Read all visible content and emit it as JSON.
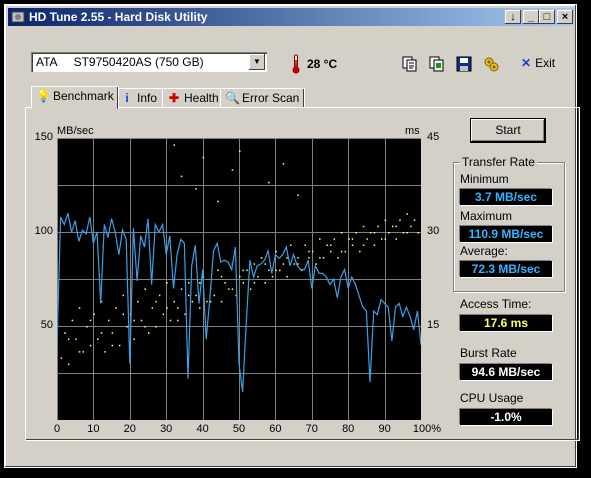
{
  "window": {
    "title": "HD Tune 2.55 - Hard Disk Utility",
    "controls": [
      "↓",
      "_",
      "□",
      "×"
    ]
  },
  "toolbar": {
    "drive": "ATA     ST9750420AS (750 GB)",
    "temperature": "28 °C",
    "tools": [
      "copy-text-icon",
      "copy-screen-icon",
      "save-icon",
      "options-icon"
    ],
    "exit_label": "Exit"
  },
  "tabs": [
    {
      "label": "Benchmark",
      "icon": "benchmark-icon",
      "active": true
    },
    {
      "label": "Info",
      "icon": "info-icon",
      "active": false
    },
    {
      "label": "Health",
      "icon": "health-icon",
      "active": false
    },
    {
      "label": "Error Scan",
      "icon": "error-scan-icon",
      "active": false
    }
  ],
  "benchmark": {
    "start_label": "Start",
    "left_unit": "MB/sec",
    "right_unit": "ms",
    "transfer_rate": {
      "group_label": "Transfer Rate",
      "minimum_label": "Minimum",
      "minimum": "3.7 MB/sec",
      "maximum_label": "Maximum",
      "maximum": "110.9 MB/sec",
      "average_label": "Average:",
      "average": "72.3 MB/sec"
    },
    "access_time_label": "Access Time:",
    "access_time": "17.6 ms",
    "burst_rate_label": "Burst Rate",
    "burst_rate": "94.6 MB/sec",
    "cpu_usage_label": "CPU Usage",
    "cpu_usage": "-1.0%",
    "colors": {
      "transfer_line": "#3ca0e6",
      "access_dots": "#ffff80",
      "value_blue": "#33b5ff",
      "value_yellow": "#ffff66",
      "value_white": "#ffffff"
    }
  },
  "chart_data": {
    "type": "line",
    "x_ticks": [
      "0",
      "10",
      "20",
      "30",
      "40",
      "50",
      "60",
      "70",
      "80",
      "90",
      "100%"
    ],
    "y_left_ticks": [
      "150",
      "100",
      "50"
    ],
    "y_right_ticks": [
      "45",
      "30",
      "15"
    ],
    "ylim_left": [
      0,
      150
    ],
    "ylim_right": [
      0,
      45
    ],
    "xlim": [
      0,
      100
    ],
    "grid": true,
    "series": [
      {
        "x": [
          0,
          1,
          2,
          3,
          4,
          5,
          6,
          7,
          8,
          9,
          10,
          11,
          12,
          13,
          14,
          15,
          16,
          17,
          18,
          19,
          20,
          21,
          22,
          23,
          24,
          25,
          26,
          27,
          28,
          29,
          30,
          31,
          32,
          33,
          34,
          35,
          36,
          37,
          38,
          39,
          40,
          41,
          42,
          43,
          44,
          45,
          46,
          47,
          48,
          49,
          50,
          51,
          52,
          53,
          54,
          55,
          56,
          57,
          58,
          59,
          60,
          61,
          62,
          63,
          64,
          65,
          66,
          67,
          68,
          69,
          70,
          71,
          72,
          73,
          74,
          75,
          76,
          77,
          78,
          79,
          80,
          81,
          82,
          83,
          84,
          85,
          86,
          87,
          88,
          89,
          90,
          91,
          92,
          93,
          94,
          95,
          96,
          97,
          98,
          99,
          100
        ],
        "values": [
          40,
          108,
          104,
          110,
          100,
          106,
          95,
          101,
          99,
          108,
          94,
          100,
          62,
          104,
          97,
          107,
          100,
          88,
          101,
          96,
          30,
          102,
          74,
          98,
          92,
          107,
          72,
          104,
          100,
          104,
          88,
          98,
          70,
          88,
          96,
          94,
          22,
          82,
          93,
          62,
          80,
          43,
          65,
          90,
          94,
          84,
          85,
          84,
          80,
          92,
          30,
          15,
          52,
          85,
          76,
          82,
          83,
          85,
          90,
          78,
          88,
          86,
          88,
          92,
          82,
          88,
          82,
          80,
          80,
          85,
          70,
          82,
          78,
          78,
          76,
          72,
          75,
          65,
          76,
          80,
          70,
          76,
          72,
          66,
          60,
          58,
          20,
          58,
          56,
          64,
          62,
          60,
          42,
          60,
          62,
          55,
          60,
          55,
          48,
          58,
          40
        ]
      }
    ],
    "access_time_ms_scatter": [
      [
        1,
        10
      ],
      [
        2,
        14
      ],
      [
        3,
        9
      ],
      [
        4,
        16
      ],
      [
        5,
        13
      ],
      [
        6,
        18
      ],
      [
        7,
        11
      ],
      [
        8,
        15
      ],
      [
        9,
        12
      ],
      [
        10,
        17
      ],
      [
        11,
        13
      ],
      [
        12,
        19
      ],
      [
        13,
        11
      ],
      [
        14,
        16
      ],
      [
        15,
        14
      ],
      [
        16,
        18
      ],
      [
        17,
        12
      ],
      [
        18,
        20
      ],
      [
        19,
        15
      ],
      [
        20,
        17
      ],
      [
        21,
        13
      ],
      [
        22,
        19
      ],
      [
        23,
        16
      ],
      [
        24,
        21
      ],
      [
        25,
        14
      ],
      [
        26,
        18
      ],
      [
        27,
        15
      ],
      [
        28,
        20
      ],
      [
        29,
        17
      ],
      [
        30,
        22
      ],
      [
        31,
        16
      ],
      [
        32,
        19
      ],
      [
        33,
        18
      ],
      [
        34,
        21
      ],
      [
        35,
        17
      ],
      [
        36,
        22
      ],
      [
        37,
        19
      ],
      [
        38,
        20
      ],
      [
        39,
        18
      ],
      [
        40,
        23
      ],
      [
        41,
        19
      ],
      [
        42,
        21
      ],
      [
        43,
        20
      ],
      [
        44,
        24
      ],
      [
        45,
        19
      ],
      [
        46,
        22
      ],
      [
        47,
        21
      ],
      [
        48,
        25
      ],
      [
        49,
        20
      ],
      [
        50,
        23
      ],
      [
        51,
        22
      ],
      [
        52,
        24
      ],
      [
        53,
        21
      ],
      [
        54,
        25
      ],
      [
        55,
        23
      ],
      [
        56,
        26
      ],
      [
        57,
        22
      ],
      [
        58,
        24
      ],
      [
        59,
        23
      ],
      [
        60,
        27
      ],
      [
        61,
        24
      ],
      [
        62,
        25
      ],
      [
        63,
        23
      ],
      [
        64,
        28
      ],
      [
        65,
        25
      ],
      [
        66,
        26
      ],
      [
        67,
        24
      ],
      [
        68,
        28
      ],
      [
        69,
        26
      ],
      [
        70,
        27
      ],
      [
        71,
        25
      ],
      [
        72,
        29
      ],
      [
        73,
        26
      ],
      [
        74,
        28
      ],
      [
        75,
        27
      ],
      [
        76,
        29
      ],
      [
        77,
        26
      ],
      [
        78,
        30
      ],
      [
        79,
        27
      ],
      [
        80,
        29
      ],
      [
        81,
        28
      ],
      [
        82,
        30
      ],
      [
        83,
        27
      ],
      [
        84,
        31
      ],
      [
        85,
        29
      ],
      [
        86,
        30
      ],
      [
        87,
        28
      ],
      [
        88,
        31
      ],
      [
        89,
        29
      ],
      [
        90,
        32
      ],
      [
        91,
        30
      ],
      [
        92,
        31
      ],
      [
        93,
        29
      ],
      [
        94,
        32
      ],
      [
        95,
        30
      ],
      [
        96,
        33
      ],
      [
        97,
        31
      ],
      [
        98,
        32
      ],
      [
        99,
        30
      ],
      [
        3,
        13
      ],
      [
        6,
        11
      ],
      [
        9,
        16
      ],
      [
        12,
        14
      ],
      [
        15,
        12
      ],
      [
        18,
        17
      ],
      [
        21,
        16
      ],
      [
        24,
        15
      ],
      [
        27,
        19
      ],
      [
        30,
        18
      ],
      [
        33,
        16
      ],
      [
        36,
        20
      ],
      [
        39,
        22
      ],
      [
        42,
        19
      ],
      [
        45,
        23
      ],
      [
        48,
        21
      ],
      [
        51,
        24
      ],
      [
        54,
        22
      ],
      [
        57,
        25
      ],
      [
        60,
        24
      ],
      [
        63,
        26
      ],
      [
        66,
        25
      ],
      [
        69,
        27
      ],
      [
        72,
        26
      ],
      [
        75,
        28
      ],
      [
        78,
        27
      ],
      [
        81,
        29
      ],
      [
        84,
        28
      ],
      [
        87,
        30
      ],
      [
        90,
        29
      ],
      [
        93,
        31
      ],
      [
        96,
        30
      ],
      [
        32,
        44
      ],
      [
        40,
        42
      ],
      [
        48,
        40
      ],
      [
        58,
        38
      ],
      [
        66,
        36
      ],
      [
        34,
        39
      ],
      [
        50,
        43
      ],
      [
        62,
        41
      ],
      [
        44,
        35
      ],
      [
        38,
        37
      ]
    ]
  }
}
